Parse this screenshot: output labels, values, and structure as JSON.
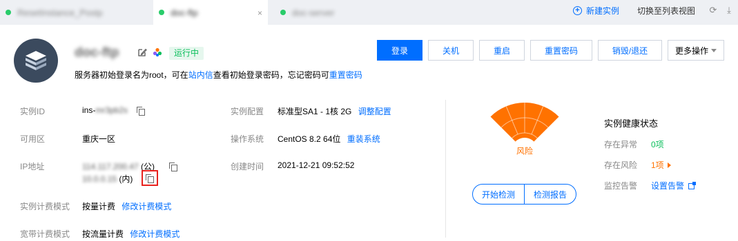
{
  "tabs": [
    {
      "label": "ResetInstance_Postp",
      "active": false,
      "status_color": "#29cc6a"
    },
    {
      "label": "doc-ftp",
      "active": true,
      "status_color": "#29cc6a"
    },
    {
      "label": "doc-server",
      "active": false,
      "status_color": "#29cc6a"
    }
  ],
  "tabs_close_symbol": "×",
  "top_actions": {
    "new_instance": "新建实例",
    "switch_list": "切换至列表视图"
  },
  "instance": {
    "name": "doc-ftp",
    "status": "运行中",
    "login_note_pre": "服务器初始登录名为root，可在",
    "login_note_link1": "站内信",
    "login_note_mid": "查看初始登录密码，忘记密码可",
    "login_note_link2": "重置密码"
  },
  "actions": {
    "login": "登录",
    "shutdown": "关机",
    "restart": "重启",
    "reset_password": "重置密码",
    "destroy": "销毁/退还",
    "more": "更多操作"
  },
  "info": {
    "instance_id_label": "实例ID",
    "instance_id_prefix": "ins-",
    "instance_id_value": "mr3pb2s",
    "zone_label": "可用区",
    "zone_value": "重庆一区",
    "ip_label": "IP地址",
    "public_ip": "114.117.200.47",
    "public_tag": "(公)",
    "private_ip": "10.0.0.15",
    "private_tag": "(内)",
    "billing_label": "实例计费模式",
    "billing_value": "按量计费",
    "billing_link": "修改计费模式",
    "bandwidth_label": "宽带计费模式",
    "bandwidth_value": "按流量计费",
    "bandwidth_link": "修改计费模式",
    "config_label": "实例配置",
    "config_value": "标准型SA1 - 1核 2G",
    "config_link": "调整配置",
    "os_label": "操作系统",
    "os_value": "CentOS 8.2 64位",
    "os_link": "重装系统",
    "created_label": "创建时间",
    "created_value": "2021-12-21 09:52:52"
  },
  "gauge": {
    "center_label": "风险",
    "color": "#ff7200",
    "start_check": "开始检测",
    "report": "检测报告"
  },
  "health": {
    "title": "实例健康状态",
    "abnormal_label": "存在异常",
    "abnormal_value": "0项",
    "risk_label": "存在风险",
    "risk_value": "1项",
    "alarm_label": "监控告警",
    "alarm_link": "设置告警"
  },
  "colors": {
    "primary": "#006eff",
    "success": "#0abf5b",
    "warning": "#ff7200",
    "highlight": "#e8211d"
  }
}
